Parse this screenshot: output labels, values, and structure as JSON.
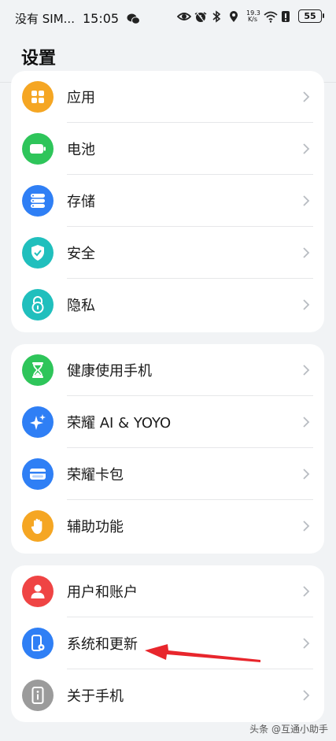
{
  "status_bar": {
    "carrier": "没有 SIM...",
    "time": "15:05",
    "net_speed_value": "19.3",
    "net_speed_unit": "K/s",
    "battery_level": "55",
    "icons": [
      "wechat-icon",
      "eye-icon",
      "alarm-icon",
      "bluetooth-icon",
      "location-icon",
      "wifi-icon",
      "alert-icon"
    ]
  },
  "header": {
    "title": "设置"
  },
  "groups": [
    {
      "items": [
        {
          "label": "应用",
          "icon": "apps-icon",
          "color": "#f5a623"
        },
        {
          "label": "电池",
          "icon": "battery-icon",
          "color": "#2ec55a"
        },
        {
          "label": "存储",
          "icon": "storage-icon",
          "color": "#2f7ff5"
        },
        {
          "label": "安全",
          "icon": "shield-icon",
          "color": "#20bfbd"
        },
        {
          "label": "隐私",
          "icon": "lock-icon",
          "color": "#20bfbd"
        }
      ]
    },
    {
      "items": [
        {
          "label": "健康使用手机",
          "icon": "hourglass-icon",
          "color": "#2ec55a"
        },
        {
          "label": "荣耀 AI & YOYO",
          "icon": "sparkle-icon",
          "color": "#2f7ff5"
        },
        {
          "label": "荣耀卡包",
          "icon": "wallet-icon",
          "color": "#2f7ff5"
        },
        {
          "label": "辅助功能",
          "icon": "hand-icon",
          "color": "#f5a623"
        }
      ]
    },
    {
      "items": [
        {
          "label": "用户和账户",
          "icon": "user-icon",
          "color": "#ef4444"
        },
        {
          "label": "系统和更新",
          "icon": "phone-gear-icon",
          "color": "#2f7ff5"
        },
        {
          "label": "关于手机",
          "icon": "info-icon",
          "color": "#9b9b9b"
        }
      ]
    }
  ],
  "annotation": {
    "arrow_color": "#e8262c"
  },
  "watermark": "头条 @互通小助手"
}
